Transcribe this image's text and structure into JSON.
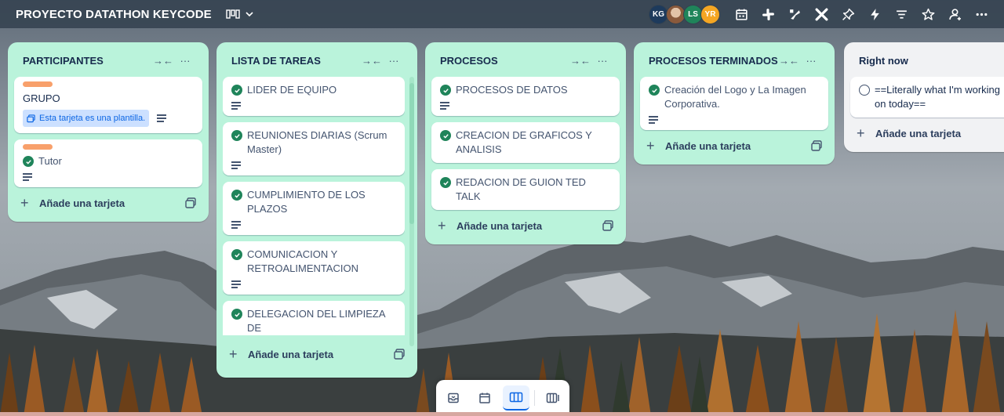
{
  "board": {
    "title": "PROYECTO DATATHON KEYCODE",
    "view_icon": "board-view-icon"
  },
  "members": [
    {
      "initials": "KG",
      "color": "#1d3a5c"
    },
    {
      "initials": "",
      "color": "#c9a27e",
      "is_photo": true
    },
    {
      "initials": "LS",
      "color": "#1f845a"
    },
    {
      "initials": "YR",
      "color": "#f5a623"
    }
  ],
  "toolbar_icons": [
    "calendar-icon",
    "slack-icon",
    "butler-icon",
    "integration-icon",
    "pin-icon",
    "automation-icon",
    "filter-icon",
    "star-icon",
    "share-icon",
    "more-icon"
  ],
  "lists": [
    {
      "title": "PARTICIPANTES",
      "collapse_icon": "→←",
      "menu_icon": "···",
      "cards": [
        {
          "label_color": "#f8a06b",
          "text": "GRUPO",
          "check": "none",
          "template_chip": "Esta tarjeta es una plantilla.",
          "has_description": true
        },
        {
          "label_color": "#f8a06b",
          "text": "Tutor",
          "check": "done",
          "has_description": true
        }
      ],
      "add_label": "Añade una tarjeta"
    },
    {
      "title": "LISTA DE TAREAS",
      "collapse_icon": "→←",
      "menu_icon": "···",
      "cards": [
        {
          "text": "LIDER DE EQUIPO",
          "check": "done",
          "has_description": true
        },
        {
          "text": "REUNIONES DIARIAS (Scrum Master)",
          "check": "done",
          "has_description": true
        },
        {
          "text": "CUMPLIMIENTO DE LOS PLAZOS",
          "check": "done",
          "has_description": true
        },
        {
          "text": "COMUNICACION Y RETROALIMENTACION",
          "check": "done",
          "has_description": true
        },
        {
          "text": "DELEGACION DEL LIMPIEZA DE",
          "check": "done",
          "has_description": false
        }
      ],
      "add_label": "Añade una tarjeta"
    },
    {
      "title": "PROCESOS",
      "collapse_icon": "→←",
      "menu_icon": "···",
      "cards": [
        {
          "text": "PROCESOS DE DATOS",
          "check": "done",
          "has_description": true
        },
        {
          "text": "CREACION DE GRAFICOS Y ANALISIS",
          "check": "done",
          "has_description": false
        },
        {
          "text": "REDACION DE GUION TED TALK",
          "check": "done",
          "has_description": false
        }
      ],
      "add_label": "Añade una tarjeta"
    },
    {
      "title": "PROCESOS TERMINADOS",
      "collapse_icon": "→←",
      "menu_icon": "···",
      "cards": [
        {
          "text": "Creación del Logo y La Imagen Corporativa.",
          "check": "done",
          "has_description": true
        }
      ],
      "add_label": "Añade una tarjeta"
    },
    {
      "title": "Right now",
      "collapse_icon": "→",
      "cards": [
        {
          "text": "==Literally what I'm working on today==",
          "check": "open",
          "has_description": false
        }
      ],
      "add_label": "Añade una tarjeta"
    }
  ],
  "bottom_nav": [
    "inbox-icon",
    "planner-icon",
    "board-icon",
    "switch-boards-icon"
  ],
  "colors": {
    "list_bg": "#baf3db",
    "check_green": "#1f845a",
    "label_orange": "#f8a06b"
  }
}
